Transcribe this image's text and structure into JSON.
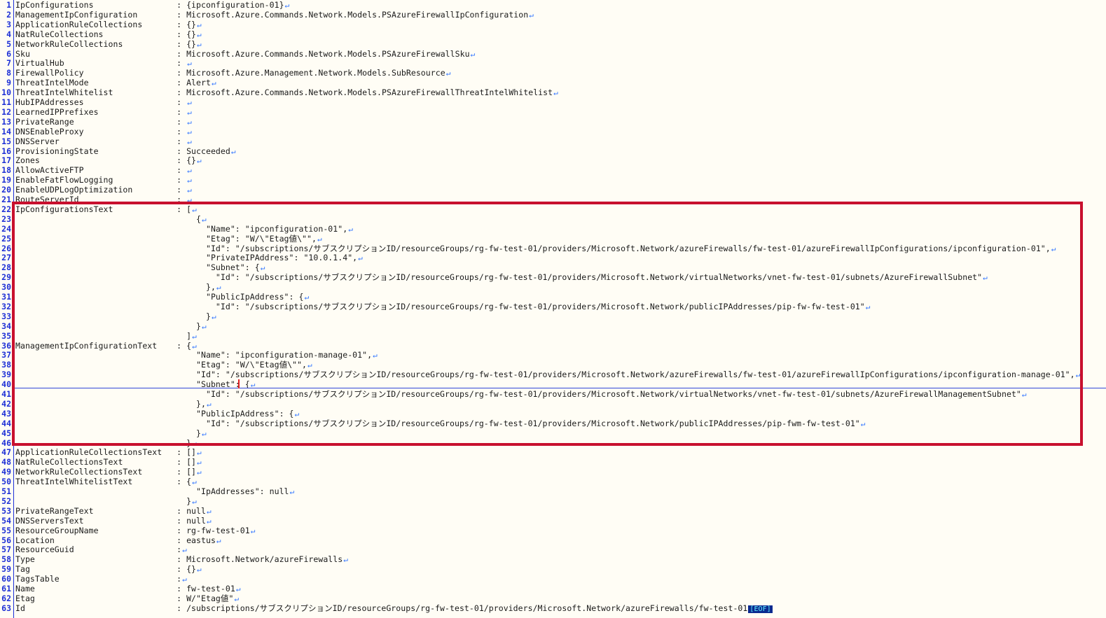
{
  "editor": {
    "eof_marker": "[EOF]",
    "eol_glyph": "↵",
    "lines": [
      {
        "num": "1",
        "text": "IpConfigurations                 : {ipconfiguration-01}"
      },
      {
        "num": "2",
        "text": "ManagementIpConfiguration        : Microsoft.Azure.Commands.Network.Models.PSAzureFirewallIpConfiguration"
      },
      {
        "num": "3",
        "text": "ApplicationRuleCollections       : {}"
      },
      {
        "num": "4",
        "text": "NatRuleCollections               : {}"
      },
      {
        "num": "5",
        "text": "NetworkRuleCollections           : {}"
      },
      {
        "num": "6",
        "text": "Sku                              : Microsoft.Azure.Commands.Network.Models.PSAzureFirewallSku"
      },
      {
        "num": "7",
        "text": "VirtualHub                       : "
      },
      {
        "num": "8",
        "text": "FirewallPolicy                   : Microsoft.Azure.Management.Network.Models.SubResource"
      },
      {
        "num": "9",
        "text": "ThreatIntelMode                  : Alert"
      },
      {
        "num": "10",
        "text": "ThreatIntelWhitelist             : Microsoft.Azure.Commands.Network.Models.PSAzureFirewallThreatIntelWhitelist"
      },
      {
        "num": "11",
        "text": "HubIPAddresses                   : "
      },
      {
        "num": "12",
        "text": "LearnedIPPrefixes                : "
      },
      {
        "num": "13",
        "text": "PrivateRange                     : "
      },
      {
        "num": "14",
        "text": "DNSEnableProxy                   : "
      },
      {
        "num": "15",
        "text": "DNSServer                        : "
      },
      {
        "num": "16",
        "text": "ProvisioningState                : Succeeded"
      },
      {
        "num": "17",
        "text": "Zones                            : {}"
      },
      {
        "num": "18",
        "text": "AllowActiveFTP                   : "
      },
      {
        "num": "19",
        "text": "EnableFatFlowLogging             : "
      },
      {
        "num": "20",
        "text": "EnableUDPLogOptimization         : "
      },
      {
        "num": "21",
        "text": "RouteServerId                    : "
      },
      {
        "num": "22",
        "text": "IpConfigurationsText             : ["
      },
      {
        "num": "23",
        "text": "                                     {"
      },
      {
        "num": "24",
        "text": "                                       \"Name\": \"ipconfiguration-01\","
      },
      {
        "num": "25",
        "text": "                                       \"Etag\": \"W/\\\"Etag値\\\"\","
      },
      {
        "num": "26",
        "text": "                                       \"Id\": \"/subscriptions/サブスクリプションID/resourceGroups/rg-fw-test-01/providers/Microsoft.Network/azureFirewalls/fw-test-01/azureFirewallIpConfigurations/ipconfiguration-01\","
      },
      {
        "num": "27",
        "text": "                                       \"PrivateIPAddress\": \"10.0.1.4\","
      },
      {
        "num": "28",
        "text": "                                       \"Subnet\": {"
      },
      {
        "num": "29",
        "text": "                                         \"Id\": \"/subscriptions/サブスクリプションID/resourceGroups/rg-fw-test-01/providers/Microsoft.Network/virtualNetworks/vnet-fw-test-01/subnets/AzureFirewallSubnet\""
      },
      {
        "num": "30",
        "text": "                                       },"
      },
      {
        "num": "31",
        "text": "                                       \"PublicIpAddress\": {"
      },
      {
        "num": "32",
        "text": "                                         \"Id\": \"/subscriptions/サブスクリプションID/resourceGroups/rg-fw-test-01/providers/Microsoft.Network/publicIPAddresses/pip-fw-fw-test-01\""
      },
      {
        "num": "33",
        "text": "                                       }"
      },
      {
        "num": "34",
        "text": "                                     }"
      },
      {
        "num": "35",
        "text": "                                   ]"
      },
      {
        "num": "36",
        "text": "ManagementIpConfigurationText    : {"
      },
      {
        "num": "37",
        "text": "                                     \"Name\": \"ipconfiguration-manage-01\","
      },
      {
        "num": "38",
        "text": "                                     \"Etag\": \"W/\\\"Etag値\\\"\","
      },
      {
        "num": "39",
        "text": "                                     \"Id\": \"/subscriptions/サブスクリプションID/resourceGroups/rg-fw-test-01/providers/Microsoft.Network/azureFirewalls/fw-test-01/azureFirewallIpConfigurations/ipconfiguration-manage-01\","
      },
      {
        "num": "40",
        "text": "                                     \"Subnet\": {"
      },
      {
        "num": "41",
        "text": "                                       \"Id\": \"/subscriptions/サブスクリプションID/resourceGroups/rg-fw-test-01/providers/Microsoft.Network/virtualNetworks/vnet-fw-test-01/subnets/AzureFirewallManagementSubnet\""
      },
      {
        "num": "42",
        "text": "                                     },"
      },
      {
        "num": "43",
        "text": "                                     \"PublicIpAddress\": {"
      },
      {
        "num": "44",
        "text": "                                       \"Id\": \"/subscriptions/サブスクリプションID/resourceGroups/rg-fw-test-01/providers/Microsoft.Network/publicIPAddresses/pip-fwm-fw-test-01\""
      },
      {
        "num": "45",
        "text": "                                     }"
      },
      {
        "num": "46",
        "text": "                                   }"
      },
      {
        "num": "47",
        "text": "ApplicationRuleCollectionsText   : []"
      },
      {
        "num": "48",
        "text": "NatRuleCollectionsText           : []"
      },
      {
        "num": "49",
        "text": "NetworkRuleCollectionsText       : []"
      },
      {
        "num": "50",
        "text": "ThreatIntelWhitelistText         : {"
      },
      {
        "num": "51",
        "text": "                                     \"IpAddresses\": null"
      },
      {
        "num": "52",
        "text": "                                   }"
      },
      {
        "num": "53",
        "text": "PrivateRangeText                 : null"
      },
      {
        "num": "54",
        "text": "DNSServersText                   : null"
      },
      {
        "num": "55",
        "text": "ResourceGroupName                : rg-fw-test-01"
      },
      {
        "num": "56",
        "text": "Location                         : eastus"
      },
      {
        "num": "57",
        "text": "ResourceGuid                     :"
      },
      {
        "num": "58",
        "text": "Type                             : Microsoft.Network/azureFirewalls"
      },
      {
        "num": "59",
        "text": "Tag                              : {}"
      },
      {
        "num": "60",
        "text": "TagsTable                        :"
      },
      {
        "num": "61",
        "text": "Name                             : fw-test-01"
      },
      {
        "num": "62",
        "text": "Etag                             : W/\"Etag値\""
      },
      {
        "num": "63",
        "text": "Id                               : /subscriptions/サブスクリプションID/resourceGroups/rg-fw-test-01/providers/Microsoft.Network/azureFirewalls/fw-test-01"
      }
    ]
  },
  "colors": {
    "line_number": "#1d2fd6",
    "highlight_border": "#c8102e",
    "background": "#fffdf5",
    "eol": "#2f74ff",
    "eof_bg": "#0b2a8f",
    "eof_fg": "#62f0ff"
  }
}
